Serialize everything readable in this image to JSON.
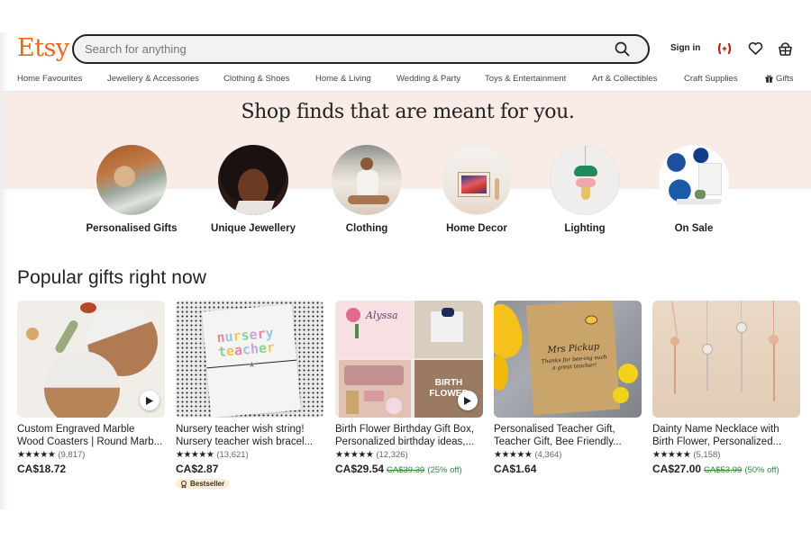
{
  "header": {
    "logo": "Etsy",
    "search_placeholder": "Search for anything",
    "search_value": "",
    "sign_in": "Sign in",
    "icons": [
      "search-icon",
      "canada-flag-icon",
      "heart-icon",
      "basket-icon"
    ]
  },
  "category_nav": [
    {
      "label": "Home Favourites"
    },
    {
      "label": "Jewellery & Accessories"
    },
    {
      "label": "Clothing & Shoes"
    },
    {
      "label": "Home & Living"
    },
    {
      "label": "Wedding & Party"
    },
    {
      "label": "Toys & Entertainment"
    },
    {
      "label": "Art & Collectibles"
    },
    {
      "label": "Craft Supplies"
    },
    {
      "label": "Gifts",
      "icon": "gift-icon"
    }
  ],
  "banner": {
    "title": "Shop finds that are meant for you.",
    "background_color": "#f9ebe6",
    "categories": [
      {
        "label": "Personalised Gifts",
        "image": "dog-on-bed-photo"
      },
      {
        "label": "Unique Jewellery",
        "image": "woman-earrings-photo"
      },
      {
        "label": "Clothing",
        "image": "woman-white-outfit-photo"
      },
      {
        "label": "Home Decor",
        "image": "framed-art-photo"
      },
      {
        "label": "Lighting",
        "image": "pendant-lamp-photo"
      },
      {
        "label": "On Sale",
        "image": "blue-floral-wallpaper-photo"
      }
    ]
  },
  "popular": {
    "title": "Popular gifts right now",
    "items": [
      {
        "title_line1": "Custom Engraved Marble",
        "title_line2": "Wood Coasters | Round Marb...",
        "stars": "★★★★★",
        "reviews": "(9,817)",
        "price": "CA$18.72",
        "original_price": "",
        "discount": "",
        "badge": "",
        "has_video": true,
        "image": "engraved-marble-coasters-photo"
      },
      {
        "title_line1": "Nursery teacher wish string!",
        "title_line2": "Nursery teacher wish bracel...",
        "stars": "★★★★★",
        "reviews": "(13,621)",
        "price": "CA$2.87",
        "original_price": "",
        "discount": "",
        "badge": "Bestseller",
        "has_video": false,
        "image": "nursery-teacher-card-photo"
      },
      {
        "title_line1": "Birth Flower Birthday Gift Box,",
        "title_line2": "Personalized birthday ideas,...",
        "stars": "★★★★★",
        "reviews": "(12,326)",
        "price": "CA$29.54",
        "original_price": "CA$39.39",
        "discount": "(25% off)",
        "badge": "",
        "has_video": true,
        "image": "birth-flower-gift-box-photo"
      },
      {
        "title_line1": "Personalised Teacher Gift,",
        "title_line2": "Teacher Gift, Bee Friendly...",
        "stars": "★★★★★",
        "reviews": "(4,364)",
        "price": "CA$1.64",
        "original_price": "",
        "discount": "",
        "badge": "",
        "has_video": false,
        "image": "mrs-pickup-seed-packet-photo"
      },
      {
        "title_line1": "Dainty Name Necklace with",
        "title_line2": "Birth Flower, Personalized...",
        "stars": "★★★★★",
        "reviews": "(5,158)",
        "price": "CA$27.00",
        "original_price": "CA$53.99",
        "discount": "(50% off)",
        "badge": "",
        "has_video": false,
        "image": "name-necklaces-photo"
      }
    ]
  },
  "colors": {
    "brand": "#f1641e",
    "sale_green": "#2f8a3a",
    "badge_bg": "#fdebd2"
  }
}
